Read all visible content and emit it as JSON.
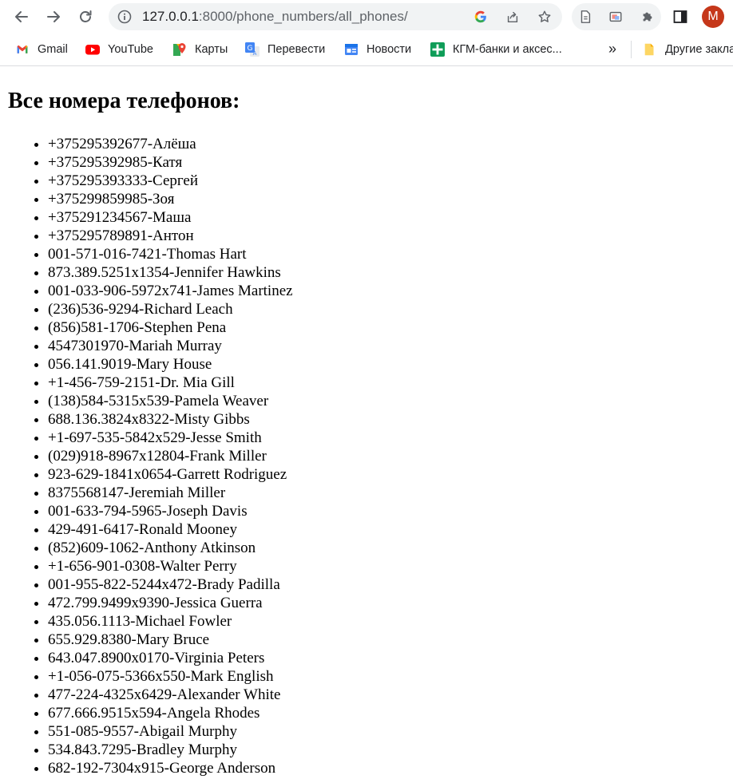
{
  "browser": {
    "url_host": "127.0.0.1",
    "url_rest": ":8000/phone_numbers/all_phones/",
    "avatar_letter": "M",
    "avatar_color": "#c5371a"
  },
  "bookmarks": {
    "items": [
      {
        "label": "Gmail",
        "icon": "gmail-icon"
      },
      {
        "label": "YouTube",
        "icon": "youtube-icon"
      },
      {
        "label": "Карты",
        "icon": "maps-icon"
      },
      {
        "label": "Перевести",
        "icon": "translate-icon"
      },
      {
        "label": "Новости",
        "icon": "news-icon"
      },
      {
        "label": "КГМ-банки и аксес...",
        "icon": "sheets-icon"
      }
    ],
    "more": "»",
    "other_label": "Другие закла"
  },
  "page": {
    "title": "Все номера телефонов:",
    "phones": [
      "+375295392677-Алёша",
      "+375295392985-Катя",
      "+375295393333-Сергей",
      "+375299859985-Зоя",
      "+375291234567-Маша",
      "+375295789891-Антон",
      "001-571-016-7421-Thomas Hart",
      "873.389.5251x1354-Jennifer Hawkins",
      "001-033-906-5972x741-James Martinez",
      "(236)536-9294-Richard Leach",
      "(856)581-1706-Stephen Pena",
      "4547301970-Mariah Murray",
      "056.141.9019-Mary House",
      "+1-456-759-2151-Dr. Mia Gill",
      "(138)584-5315x539-Pamela Weaver",
      "688.136.3824x8322-Misty Gibbs",
      "+1-697-535-5842x529-Jesse Smith",
      "(029)918-8967x12804-Frank Miller",
      "923-629-1841x0654-Garrett Rodriguez",
      "8375568147-Jeremiah Miller",
      "001-633-794-5965-Joseph Davis",
      "429-491-6417-Ronald Mooney",
      "(852)609-1062-Anthony Atkinson",
      "+1-656-901-0308-Walter Perry",
      "001-955-822-5244x472-Brady Padilla",
      "472.799.9499x9390-Jessica Guerra",
      "435.056.1113-Michael Fowler",
      "655.929.8380-Mary Bruce",
      "643.047.8900x0170-Virginia Peters",
      "+1-056-075-5366x550-Mark English",
      "477-224-4325x6429-Alexander White",
      "677.666.9515x594-Angela Rhodes",
      "551-085-9557-Abigail Murphy",
      "534.843.7295-Bradley Murphy",
      "682-192-7304x915-George Anderson"
    ]
  }
}
